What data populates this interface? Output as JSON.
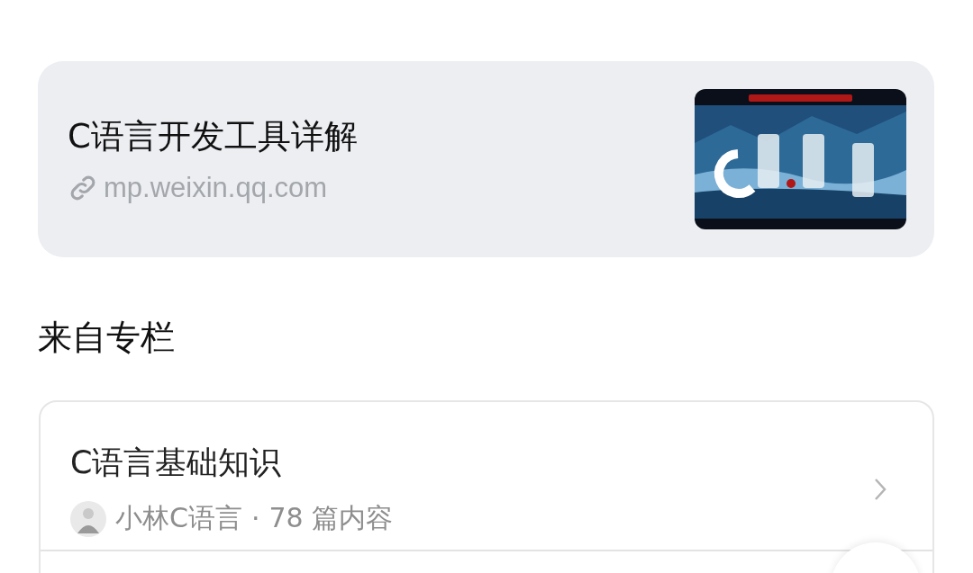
{
  "link_card": {
    "title": "C语言开发工具详解",
    "url": "mp.weixin.qq.com"
  },
  "section_title": "来自专栏",
  "column_card": {
    "title": "C语言基础知识",
    "author": "小林C语言",
    "separator": "·",
    "count": "78 篇内容"
  }
}
